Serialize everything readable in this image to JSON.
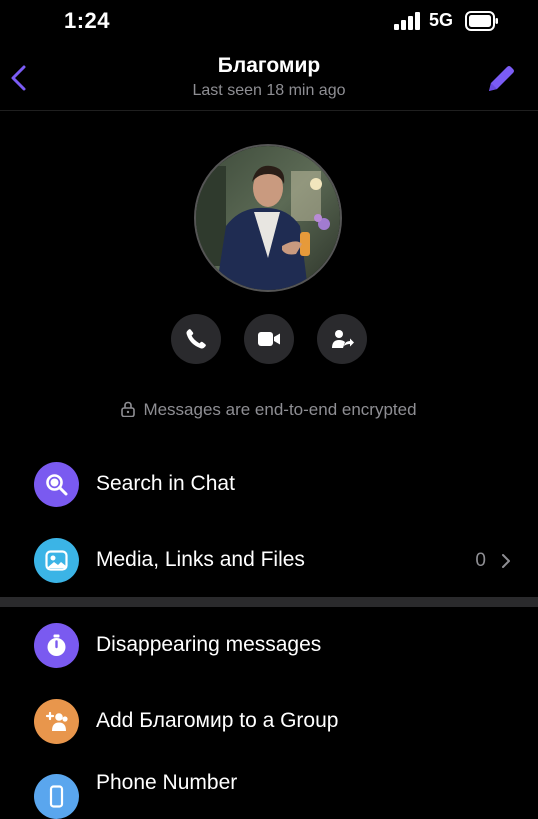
{
  "status_bar": {
    "time": "1:24",
    "network": "5G"
  },
  "header": {
    "title": "Благомир",
    "subtitle": "Last seen 18 min ago"
  },
  "encryption_note": "Messages are end-to-end encrypted",
  "menu": {
    "search": {
      "label": "Search in Chat"
    },
    "media": {
      "label": "Media, Links and Files",
      "count": "0"
    },
    "disappearing": {
      "label": "Disappearing messages"
    },
    "add_group": {
      "label": "Add Благомир to a Group"
    },
    "phone": {
      "label": "Phone Number"
    }
  },
  "colors": {
    "accent": "#7b5cf5",
    "search_icon_bg": "#7a5af0",
    "media_icon_bg": "#3bb4e6",
    "disappearing_icon_bg": "#7a5af0",
    "group_icon_bg": "#e8964c",
    "phone_icon_bg": "#5aa6ee"
  },
  "icons": [
    "back-chevron-icon",
    "pencil-icon",
    "phone-icon",
    "video-camera-icon",
    "share-contact-icon",
    "lock-icon",
    "search-icon",
    "image-icon",
    "timer-icon",
    "group-add-icon",
    "phone-device-icon",
    "chevron-right-icon"
  ]
}
